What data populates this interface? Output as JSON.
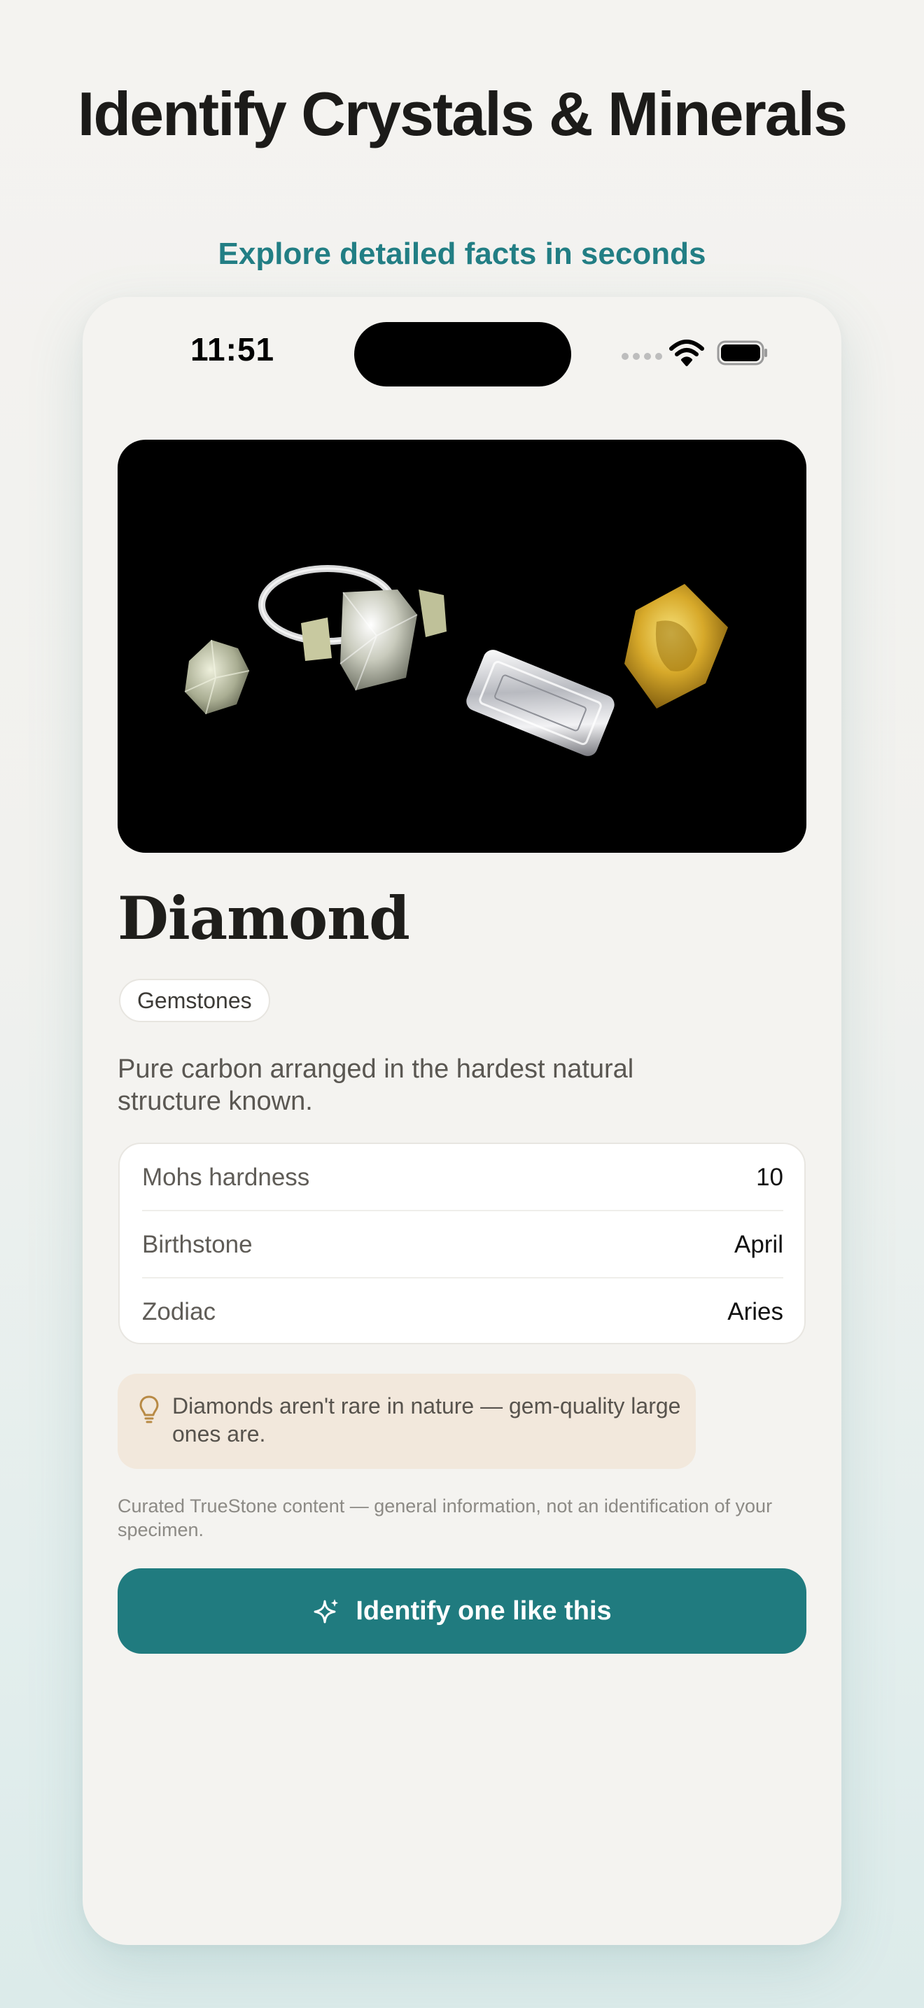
{
  "promo": {
    "headline": "Identify Crystals & Minerals",
    "subhead": "Explore detailed facts in seconds"
  },
  "status_bar": {
    "time": "11:51"
  },
  "mineral": {
    "image_icon": "diamond-gems-photo",
    "name": "Diamond",
    "category": "Gemstones",
    "description": "Pure carbon arranged in the hardest natural structure known.",
    "facts": [
      {
        "label": "Mohs hardness",
        "value": "10"
      },
      {
        "label": "Birthstone",
        "value": "April"
      },
      {
        "label": "Zodiac",
        "value": "Aries"
      }
    ],
    "tip_icon": "lightbulb-icon",
    "tip": "Diamonds aren't rare in nature — gem-quality large ones are.",
    "disclaimer": "Curated TrueStone content — general information, not an identification of your specimen."
  },
  "cta": {
    "icon": "sparkle-icon",
    "label": "Identify one like this"
  },
  "colors": {
    "accent": "#207b7f",
    "subhead": "#227e84",
    "tip_bg": "#f2e8dc",
    "page_bg": "#f4f3f0"
  }
}
